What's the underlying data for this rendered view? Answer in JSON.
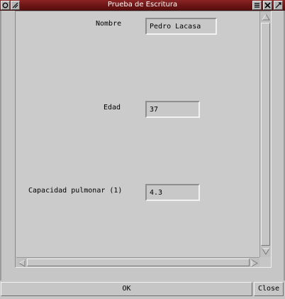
{
  "window": {
    "title": "Prueba de Escritura",
    "menu_icon": "circle-menu-icon",
    "resize_icon": "resize-icon",
    "list_icon": "window-list-icon",
    "close_icon": "close-icon",
    "maximize_icon": "maximize-icon"
  },
  "form": {
    "nombre_label": "Nombre",
    "nombre_value": "Pedro Lacasa",
    "edad_label": "Edad",
    "edad_value": "37",
    "capacidad_label": "Capacidad pulmonar (1)",
    "capacidad_value": "4.3"
  },
  "buttons": {
    "ok_label": "OK",
    "close_label": "Close"
  },
  "colors": {
    "titlebar": "#6a1414",
    "background": "#c6c6c6"
  }
}
